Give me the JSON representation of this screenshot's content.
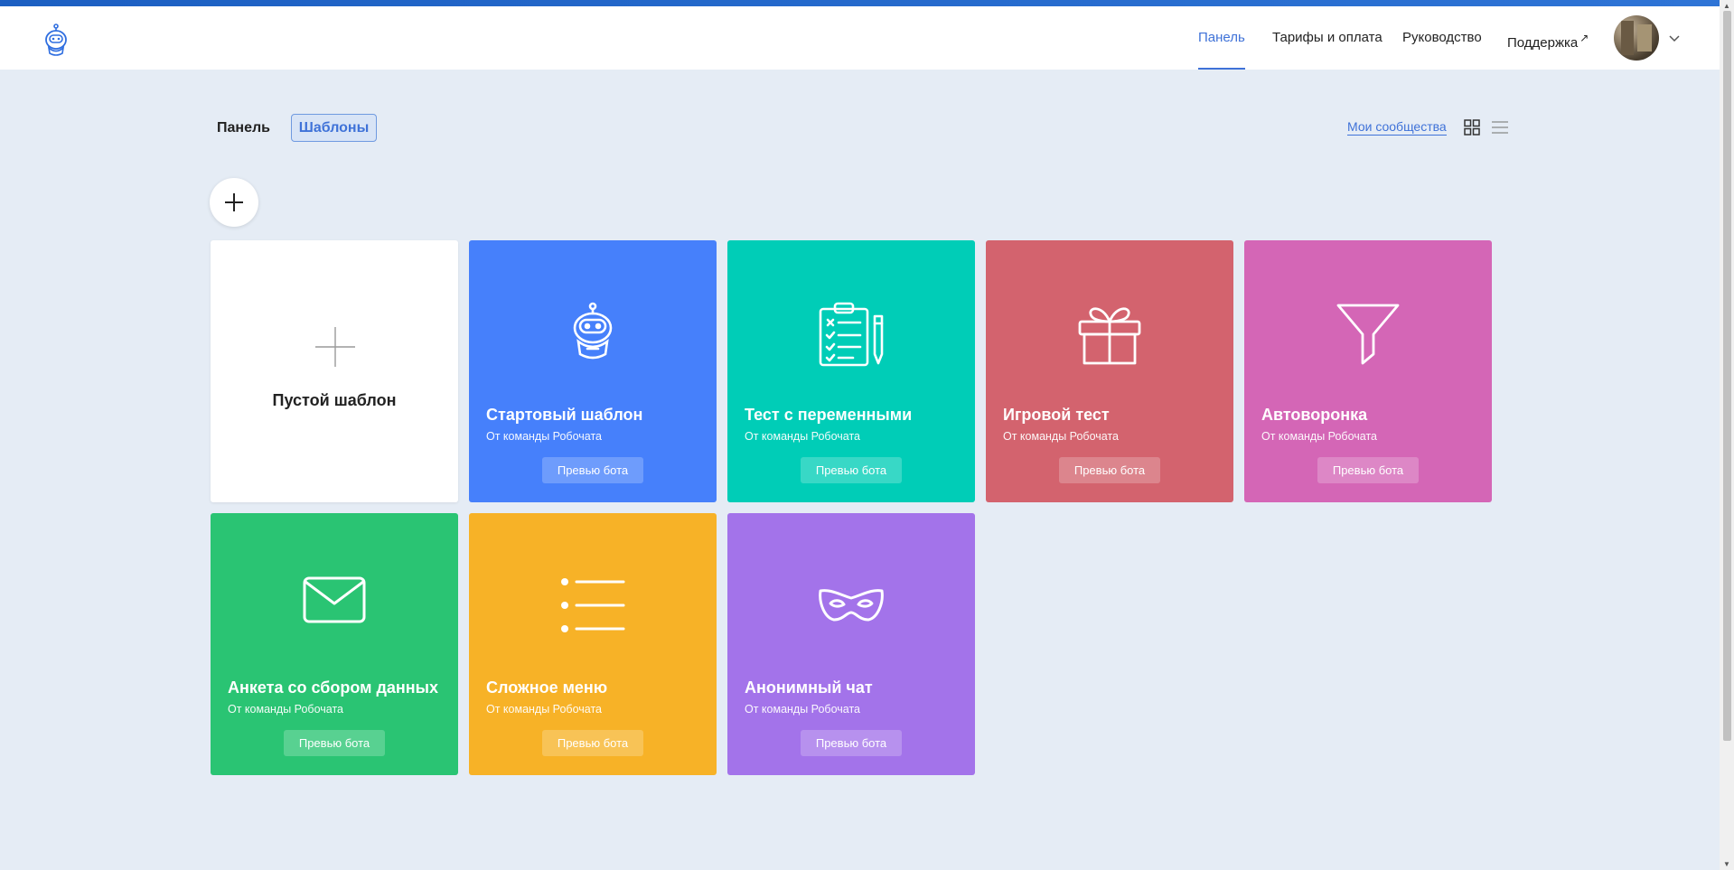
{
  "header": {
    "nav": [
      {
        "label": "Панель",
        "active": true
      },
      {
        "label": "Тарифы и оплата",
        "active": false
      },
      {
        "label": "Руководство",
        "active": false
      },
      {
        "label": "Поддержка",
        "active": false,
        "external_icon": "arrow-up-right-icon"
      }
    ],
    "accent_color": "#3f72d8"
  },
  "toolbar": {
    "tab_panel": "Панель",
    "tab_templates": "Шаблоны",
    "my_communities": "Мои сообщества"
  },
  "templates": {
    "empty": {
      "title": "Пустой шаблон"
    },
    "preview_label": "Превью бота",
    "items": [
      {
        "title": "Стартовый шаблон",
        "subtitle": "От команды Робочата",
        "preview": "Превью бота",
        "color": "#4680fb",
        "icon": "robot-icon"
      },
      {
        "title": "Тест с переменными",
        "subtitle": "От команды Робочата",
        "preview": "Превью бота",
        "color": "#00cdb7",
        "icon": "checklist-icon"
      },
      {
        "title": "Игровой тест",
        "subtitle": "От команды Робочата",
        "preview": "Превью бота",
        "color": "#d3636e",
        "icon": "gift-icon"
      },
      {
        "title": "Автоворонка",
        "subtitle": "От команды Робочата",
        "preview": "Превью бота",
        "color": "#d466b6",
        "icon": "funnel-icon"
      },
      {
        "title": "Анкета со сбором данных",
        "subtitle": "От команды Робочата",
        "preview": "Превью бота",
        "color": "#2ac473",
        "icon": "envelope-icon"
      },
      {
        "title": "Сложное меню",
        "subtitle": "От команды Робочата",
        "preview": "Превью бота",
        "color": "#f7b227",
        "icon": "list-icon"
      },
      {
        "title": "Анонимный чат",
        "subtitle": "От команды Робочата",
        "preview": "Превью бота",
        "color": "#a373ea",
        "icon": "mask-icon"
      }
    ]
  }
}
